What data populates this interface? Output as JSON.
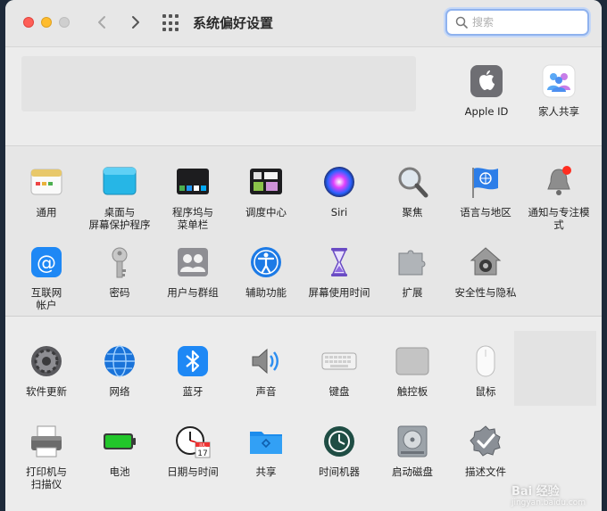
{
  "window": {
    "title": "系统偏好设置",
    "search_placeholder": "搜索"
  },
  "account": {
    "apple_id": "Apple ID",
    "family": "家人共享"
  },
  "section2": [
    {
      "label": "通用",
      "icon": "general-icon"
    },
    {
      "label": "桌面与\n屏幕保护程序",
      "icon": "desktop-icon"
    },
    {
      "label": "程序坞与\n菜单栏",
      "icon": "dock-icon"
    },
    {
      "label": "调度中心",
      "icon": "mission-control-icon"
    },
    {
      "label": "Siri",
      "icon": "siri-icon"
    },
    {
      "label": "聚焦",
      "icon": "spotlight-icon"
    },
    {
      "label": "语言与地区",
      "icon": "language-flag-icon"
    },
    {
      "label": "通知与专注模式",
      "icon": "notifications-bell-icon"
    },
    {
      "label": "互联网\n帐户",
      "icon": "internet-accounts-icon"
    },
    {
      "label": "密码",
      "icon": "key-icon"
    },
    {
      "label": "用户与群组",
      "icon": "users-icon"
    },
    {
      "label": "辅助功能",
      "icon": "accessibility-icon"
    },
    {
      "label": "屏幕使用时间",
      "icon": "hourglass-icon"
    },
    {
      "label": "扩展",
      "icon": "puzzle-icon"
    },
    {
      "label": "安全性与隐私",
      "icon": "house-lock-icon"
    }
  ],
  "section3": [
    {
      "label": "软件更新",
      "icon": "gear-icon"
    },
    {
      "label": "网络",
      "icon": "globe-icon"
    },
    {
      "label": "蓝牙",
      "icon": "bluetooth-icon"
    },
    {
      "label": "声音",
      "icon": "speaker-icon"
    },
    {
      "label": "键盘",
      "icon": "keyboard-icon"
    },
    {
      "label": "触控板",
      "icon": "trackpad-icon"
    },
    {
      "label": "鼠标",
      "icon": "mouse-icon"
    },
    {
      "label": "打印机与\n扫描仪",
      "icon": "printer-icon"
    },
    {
      "label": "电池",
      "icon": "battery-icon"
    },
    {
      "label": "日期与时间",
      "icon": "clock-calendar-icon"
    },
    {
      "label": "共享",
      "icon": "sharing-folder-icon"
    },
    {
      "label": "时间机器",
      "icon": "time-machine-icon"
    },
    {
      "label": "启动磁盘",
      "icon": "disk-icon"
    },
    {
      "label": "描述文件",
      "icon": "profiles-check-icon"
    }
  ],
  "calendar": {
    "month": "JUL",
    "day": "17"
  },
  "watermark": {
    "text": "Bai 经验",
    "sub": "jingyan.baidu.com"
  }
}
